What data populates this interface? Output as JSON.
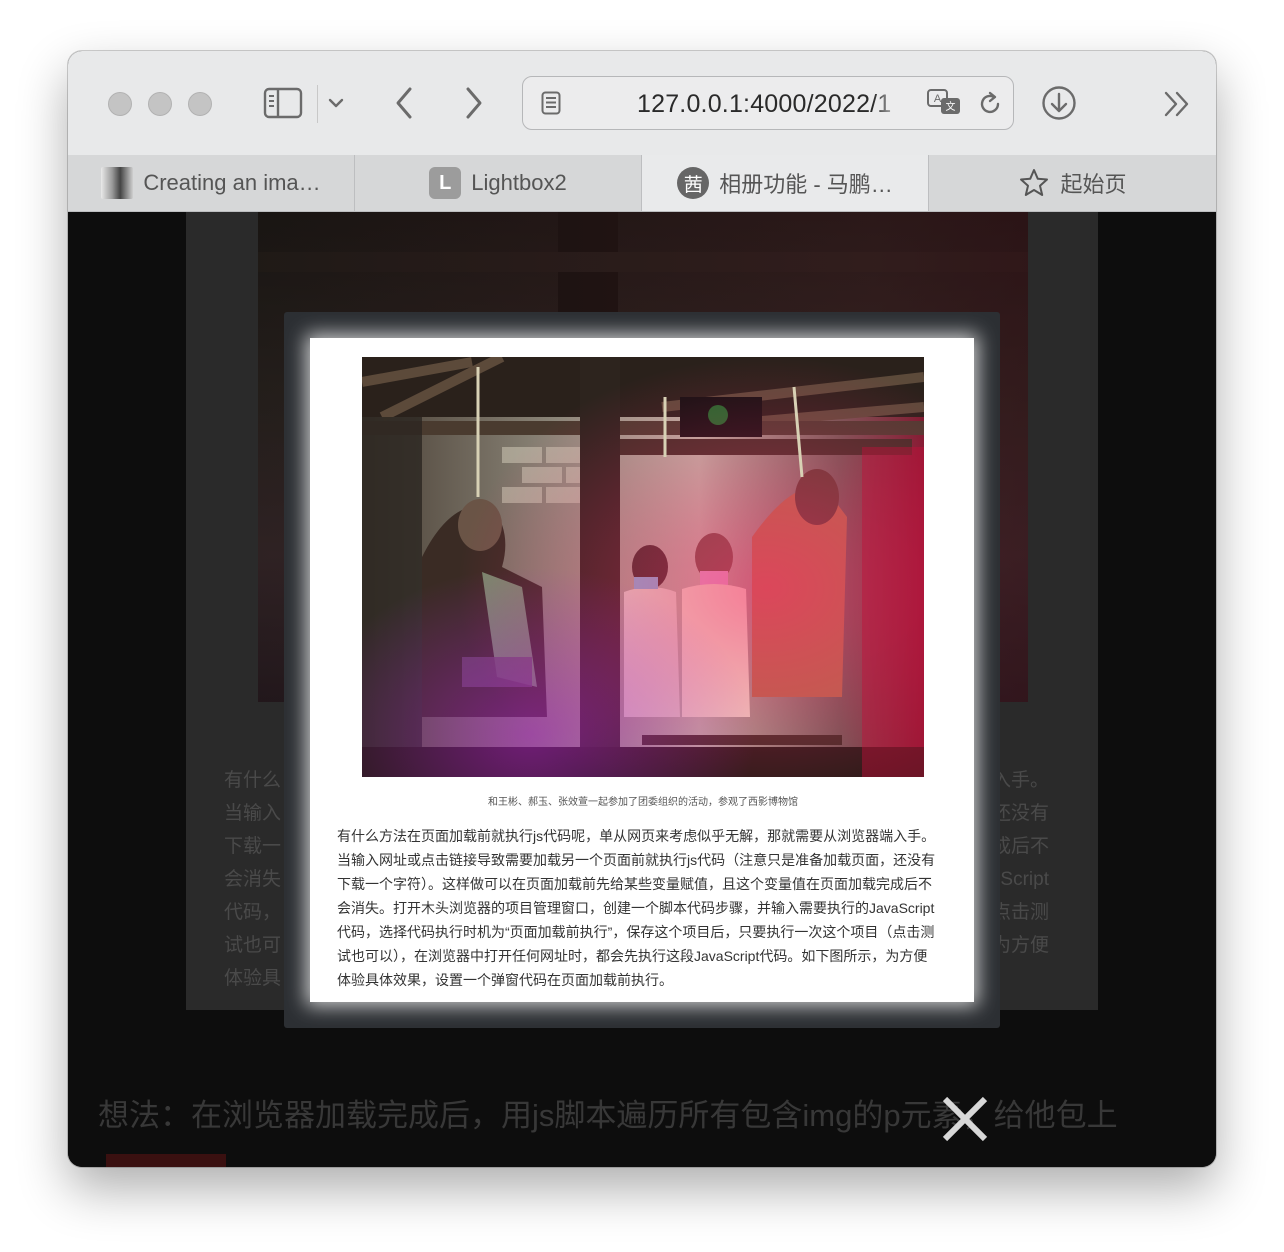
{
  "browser": {
    "url": "127.0.0.1:4000/2022/1",
    "tabs": [
      {
        "label": "Creating an ima…",
        "icon": "image-thumbnail-icon",
        "active": false
      },
      {
        "label": "Lightbox2",
        "icon_letter": "L",
        "icon": "letter-l-icon",
        "active": false
      },
      {
        "label": "相册功能 - 马鹏…",
        "icon_letter": "茜",
        "icon": "site-logo-icon",
        "active": true
      },
      {
        "label": "起始页",
        "icon": "star-icon",
        "active": false
      }
    ]
  },
  "page": {
    "background_text_lines": [
      [
        "有什么",
        "入手。"
      ],
      [
        "当输入",
        "还没有"
      ],
      [
        "下载一",
        "成后不"
      ],
      [
        "会消失",
        "Script"
      ],
      [
        "代码，",
        "点击测"
      ],
      [
        "试也可",
        "为方便"
      ],
      [
        "体验具",
        ""
      ]
    ],
    "bottom_heading": "想法：在浏览器加载完成后，用js脚本遍历所有包含img的p元素，给他包上"
  },
  "lightbox": {
    "caption": "和王彬、郝玉、张效萱一起参加了团委组织的活动，参观了西影博物馆",
    "article_lines": [
      "有什么方法在页面加载前就执行js代码呢，单从网页来考虑似乎无解，那就需要从浏览器端入手。",
      "当输入网址或点击链接导致需要加载另一个页面前就执行js代码（注意只是准备加载页面，还没有",
      "下载一个字符）。这样做可以在页面加载前先给某些变量赋值，且这个变量值在页面加载完成后不",
      "会消失。打开木头浏览器的项目管理窗口，创建一个脚本代码步骤，并输入需要执行的JavaScript",
      "代码，选择代码执行时机为“页面加载前执行”，保存这个项目后，只要执行一次这个项目（点击测",
      "试也可以），在浏览器中打开任何网址时，都会先执行这段JavaScript代码。如下图所示，为方便",
      "体验具体效果，设置一个弹窗代码在页面加载前执行。"
    ],
    "close_icon": "close-icon"
  }
}
